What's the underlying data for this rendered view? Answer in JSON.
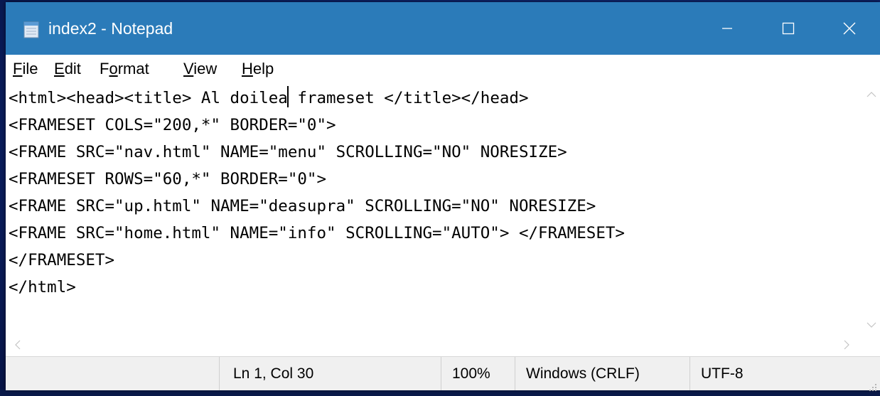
{
  "window": {
    "title": "index2 - Notepad",
    "icon": "notepad-icon",
    "controls": {
      "minimize": "minimize-icon",
      "maximize": "maximize-icon",
      "close": "close-icon"
    },
    "title_bar_color": "#2b7bb9"
  },
  "menu": {
    "file": {
      "accel": "F",
      "rest": "ile"
    },
    "edit": {
      "accel": "E",
      "rest": "dit"
    },
    "format": {
      "pre": "F",
      "accel": "o",
      "rest": "rmat"
    },
    "view": {
      "accel": "V",
      "rest": "iew"
    },
    "help": {
      "accel": "H",
      "rest": "elp"
    }
  },
  "editor": {
    "line1_before_caret": "<html><head><title> Al doilea",
    "line1_after_caret": " frameset </title></head>",
    "lines": [
      "<FRAMESET COLS=\"200,*\" BORDER=\"0\">",
      "<FRAME SRC=\"nav.html\" NAME=\"menu\" SCROLLING=\"NO\" NORESIZE>",
      "<FRAMESET ROWS=\"60,*\" BORDER=\"0\">",
      "<FRAME SRC=\"up.html\" NAME=\"deasupra\" SCROLLING=\"NO\" NORESIZE>",
      "<FRAME SRC=\"home.html\" NAME=\"info\" SCROLLING=\"AUTO\"> </FRAMESET>",
      "</FRAMESET>",
      "</html>"
    ]
  },
  "status": {
    "position": "Ln 1, Col 30",
    "zoom": "100%",
    "line_ending": "Windows (CRLF)",
    "encoding": "UTF-8"
  }
}
